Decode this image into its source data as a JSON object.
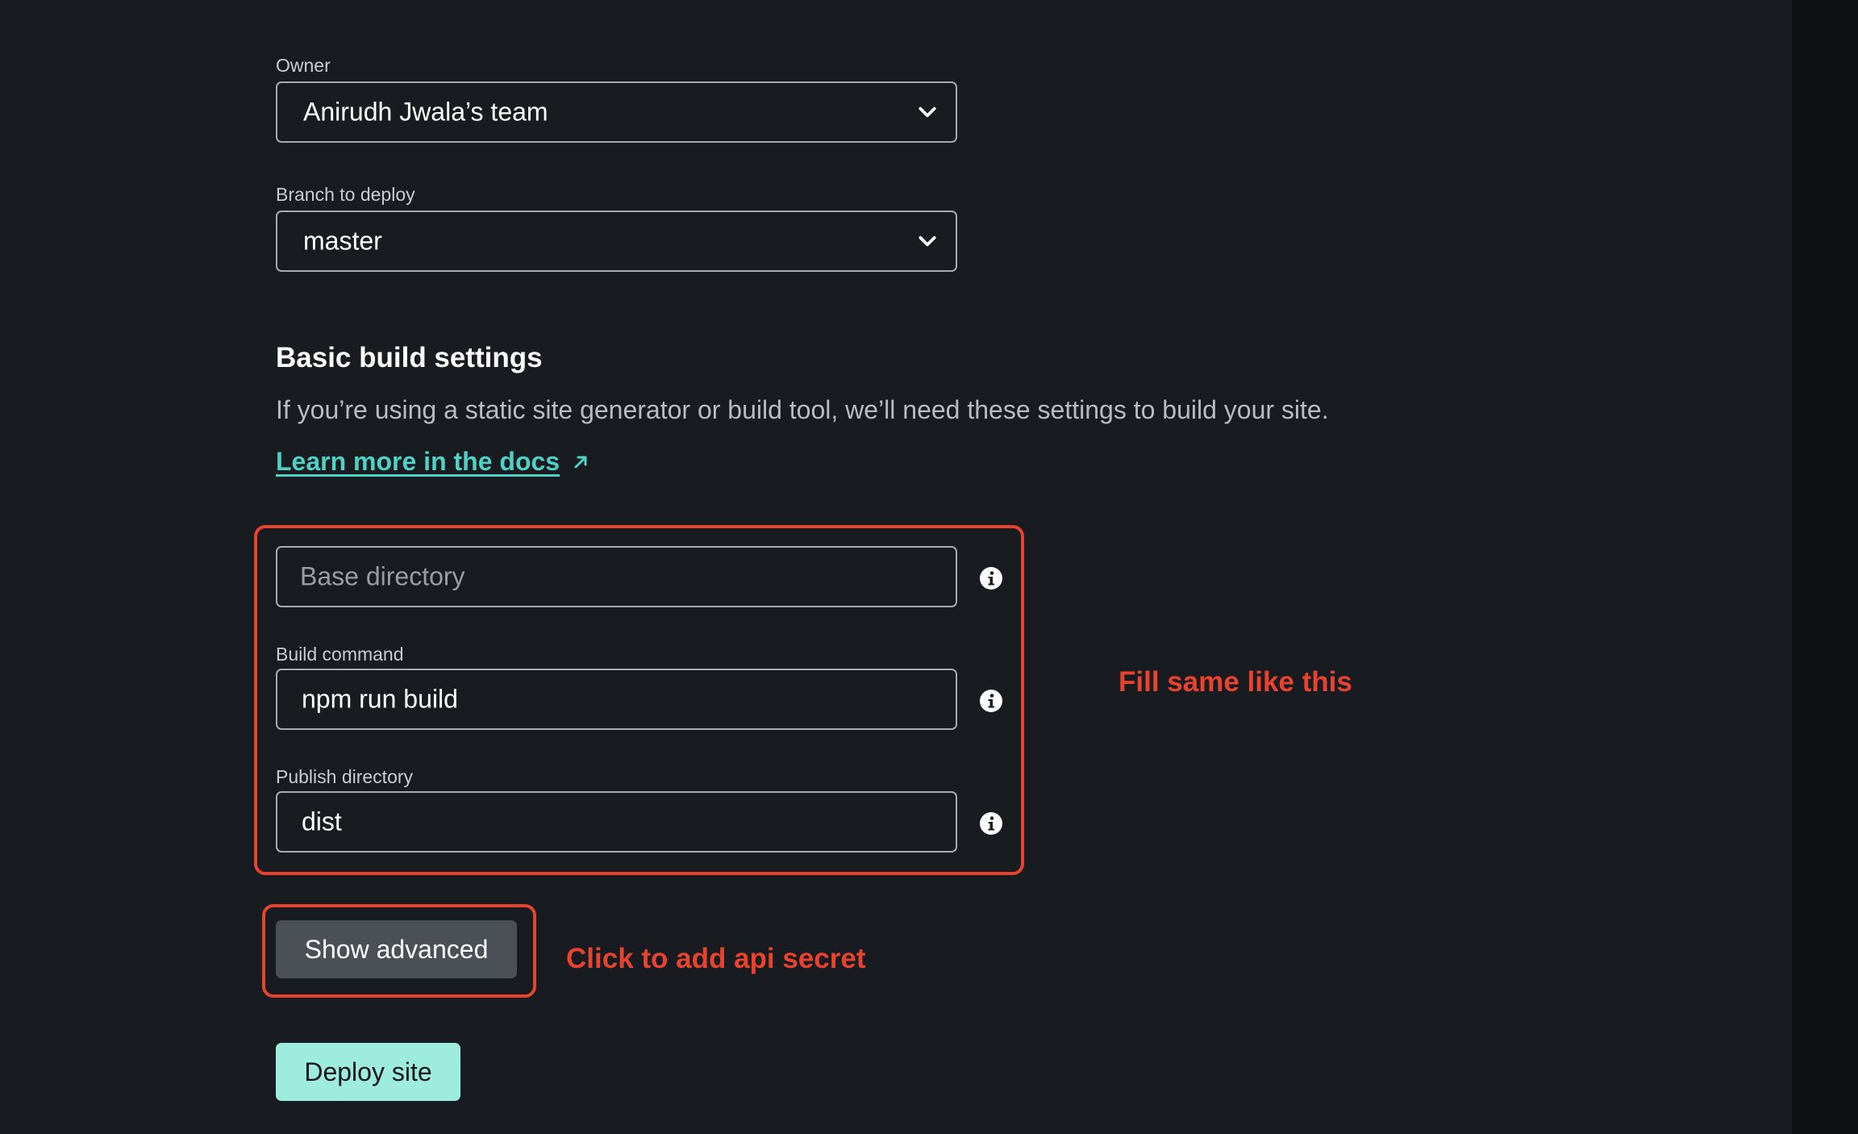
{
  "owner": {
    "label": "Owner",
    "value": "Anirudh Jwala’s team"
  },
  "branch": {
    "label": "Branch to deploy",
    "value": "master"
  },
  "build_settings": {
    "title": "Basic build settings",
    "description": "If you’re using a static site generator or build tool, we’ll need these settings to build your site.",
    "docs_link": "Learn more in the docs"
  },
  "fields": {
    "base_directory": {
      "placeholder": "Base directory"
    },
    "build_command": {
      "label": "Build command",
      "value": "npm run build"
    },
    "publish_directory": {
      "label": "Publish directory",
      "value": "dist"
    }
  },
  "buttons": {
    "show_advanced": "Show advanced",
    "deploy_site": "Deploy site"
  },
  "annotations": {
    "fill_note": "Fill same like this",
    "click_note": "Click to add api secret"
  },
  "colors": {
    "background": "#181b20",
    "accent_link": "#4fd1c5",
    "annotation_red": "#e8432e",
    "deploy_button": "#9eecdd",
    "secondary_button": "#4b4f56"
  },
  "icons": [
    "chevron-down-icon",
    "info-icon",
    "external-link-arrow-icon"
  ]
}
